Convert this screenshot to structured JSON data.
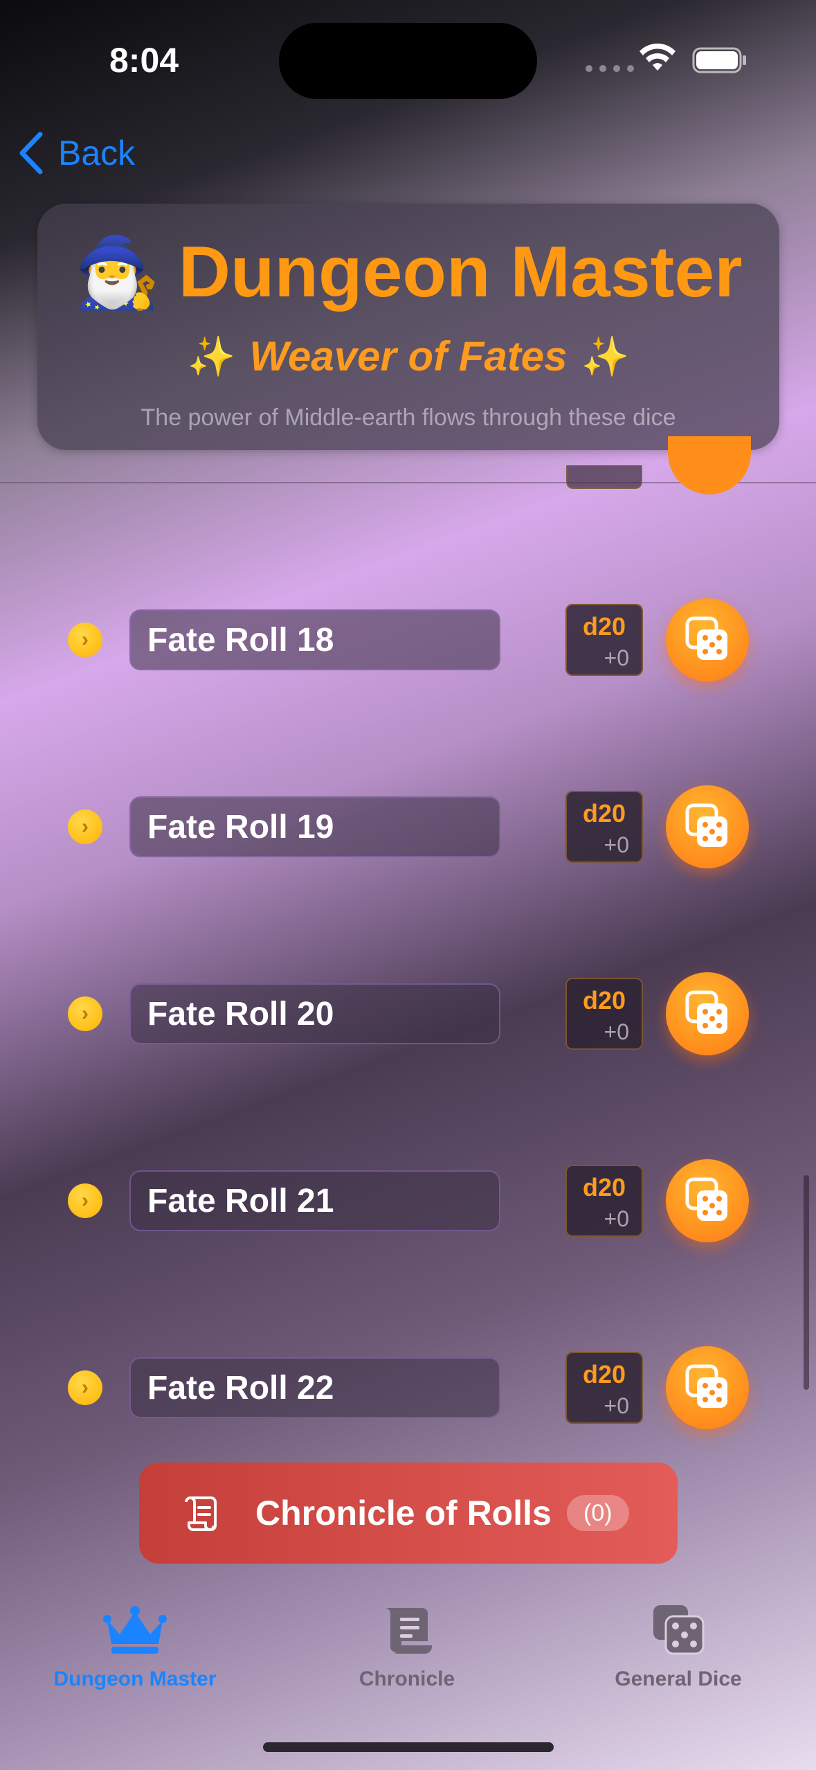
{
  "status": {
    "time": "8:04"
  },
  "nav": {
    "back_label": "Back"
  },
  "header": {
    "emoji": "🧙‍♂️",
    "title": "Dungeon Master",
    "sparkle": "✨",
    "subtitle": "Weaver of Fates",
    "tagline": "The power of Middle-earth flows through these dice"
  },
  "rolls": [
    {
      "name": "Fate Roll 18",
      "die": "d20",
      "modifier": "+0"
    },
    {
      "name": "Fate Roll 19",
      "die": "d20",
      "modifier": "+0"
    },
    {
      "name": "Fate Roll 20",
      "die": "d20",
      "modifier": "+0"
    },
    {
      "name": "Fate Roll 21",
      "die": "d20",
      "modifier": "+0"
    },
    {
      "name": "Fate Roll 22",
      "die": "d20",
      "modifier": "+0"
    }
  ],
  "chronicle_banner": {
    "label": "Chronicle of Rolls",
    "count": "(0)"
  },
  "tabs": [
    {
      "label": "Dungeon Master",
      "icon": "crown-icon",
      "active": true
    },
    {
      "label": "Chronicle",
      "icon": "scroll-icon",
      "active": false
    },
    {
      "label": "General Dice",
      "icon": "dice-icon",
      "active": false
    }
  ],
  "colors": {
    "accent": "#ff9813",
    "link": "#1a84ff",
    "banner": "#d64a47"
  }
}
